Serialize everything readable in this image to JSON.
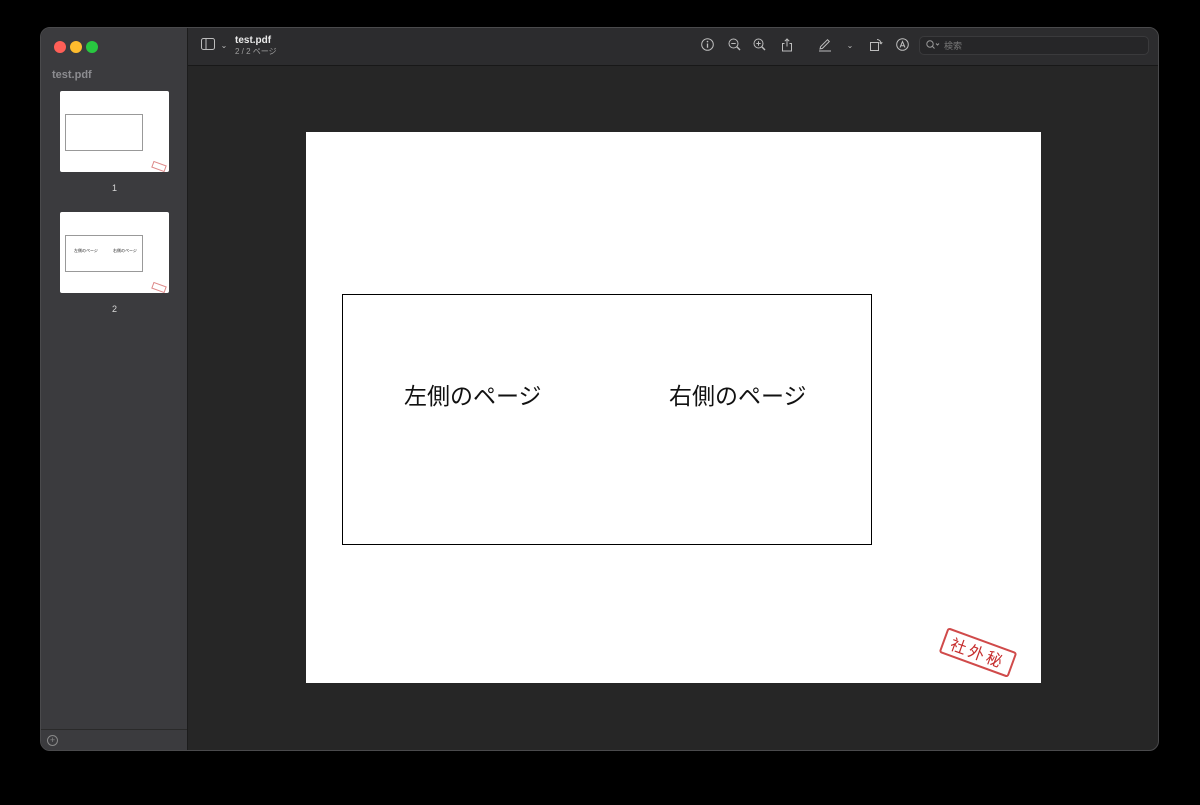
{
  "window": {
    "doc_title": "test.pdf",
    "doc_subtitle": "2 / 2 ページ"
  },
  "sidebar": {
    "title": "test.pdf",
    "thumbnails": [
      {
        "number": "1"
      },
      {
        "number": "2",
        "left_text": "左側のページ",
        "right_text": "右側のページ"
      }
    ]
  },
  "toolbar": {
    "icons": [
      "sidebar-toggle-icon",
      "chevron-down-icon",
      "info-icon",
      "zoom-out-icon",
      "zoom-in-icon",
      "share-icon",
      "markup-pen-icon",
      "chevron-down-icon",
      "rotate-icon",
      "annotate-icon"
    ]
  },
  "search": {
    "placeholder": "検索"
  },
  "document": {
    "left_text": "左側のページ",
    "right_text": "右側のページ",
    "stamp_text": "社外秘",
    "stamp_color": "#c62d2d"
  }
}
